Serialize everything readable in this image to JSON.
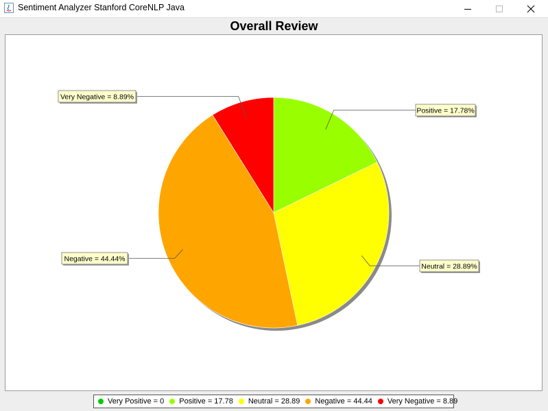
{
  "window": {
    "title": "Sentiment Analyzer Stanford CoreNLP Java",
    "icons": [
      "java-app-icon",
      "minimize-icon",
      "maximize-icon",
      "close-icon"
    ]
  },
  "chart_data": {
    "type": "pie",
    "title": "Overall Review",
    "start_angle_deg": 90,
    "direction": "clockwise",
    "slices": [
      {
        "label": "Very Positive",
        "value": 0,
        "percent": "0%",
        "color": "#00cc00",
        "callout": ""
      },
      {
        "label": "Positive",
        "value": 17.78,
        "percent": "17.78%",
        "color": "#99ff00",
        "callout": "Positive = 17.78%"
      },
      {
        "label": "Neutral",
        "value": 28.89,
        "percent": "28.89%",
        "color": "#ffff00",
        "callout": "Neutral = 28.89%"
      },
      {
        "label": "Negative",
        "value": 44.44,
        "percent": "44.44%",
        "color": "#ffa500",
        "callout": "Negative = 44.44%"
      },
      {
        "label": "Very Negative",
        "value": 8.89,
        "percent": "8.89%",
        "color": "#ff0000",
        "callout": "Very Negative = 8.89%"
      }
    ],
    "legend": {
      "placement": "bottom",
      "items": [
        {
          "text": "Very Positive = 0",
          "color": "#00cc00"
        },
        {
          "text": "Positive = 17.78",
          "color": "#99ff00"
        },
        {
          "text": "Neutral = 28.89",
          "color": "#ffff00"
        },
        {
          "text": "Negative = 44.44",
          "color": "#ffa500"
        },
        {
          "text": "Very Negative = 8.89",
          "color": "#ff0000"
        }
      ]
    }
  }
}
